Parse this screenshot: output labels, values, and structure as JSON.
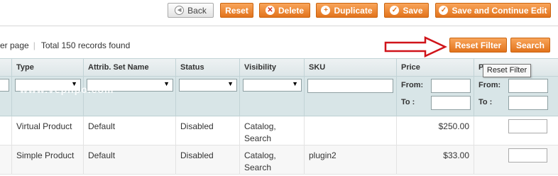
{
  "toolbar": {
    "back_label": "Back",
    "reset_label": "Reset",
    "delete_label": "Delete",
    "duplicate_label": "Duplicate",
    "save_label": "Save",
    "save_continue_label": "Save and Continue Edit"
  },
  "pager": {
    "per_page_fragment": "er page",
    "separator": "|",
    "total_text": "Total 150 records found"
  },
  "grid_actions": {
    "reset_filter_label": "Reset Filter",
    "search_label": "Search",
    "tooltip_text": "Reset Filter"
  },
  "columns": {
    "type": "Type",
    "attrib_set": "Attrib. Set Name",
    "status": "Status",
    "visibility": "Visibility",
    "sku": "SKU",
    "price": "Price",
    "position": "P"
  },
  "filters": {
    "from_label": "From:",
    "to_label": "To :"
  },
  "watermark": "www.vepnpo.com",
  "rows": [
    {
      "type": "Virtual Product",
      "attrib_set": "Default",
      "status": "Disabled",
      "visibility_1": "Catalog,",
      "visibility_2": "Search",
      "sku": "",
      "price": "$250.00"
    },
    {
      "type": "Simple Product",
      "attrib_set": "Default",
      "status": "Disabled",
      "visibility_1": "Catalog,",
      "visibility_2": "Search",
      "sku": "plugin2",
      "price": "$33.00"
    }
  ],
  "colors": {
    "accent_orange": "#e2731c",
    "arrow_red": "#d0141a",
    "filter_bg": "#d8e5e7"
  }
}
